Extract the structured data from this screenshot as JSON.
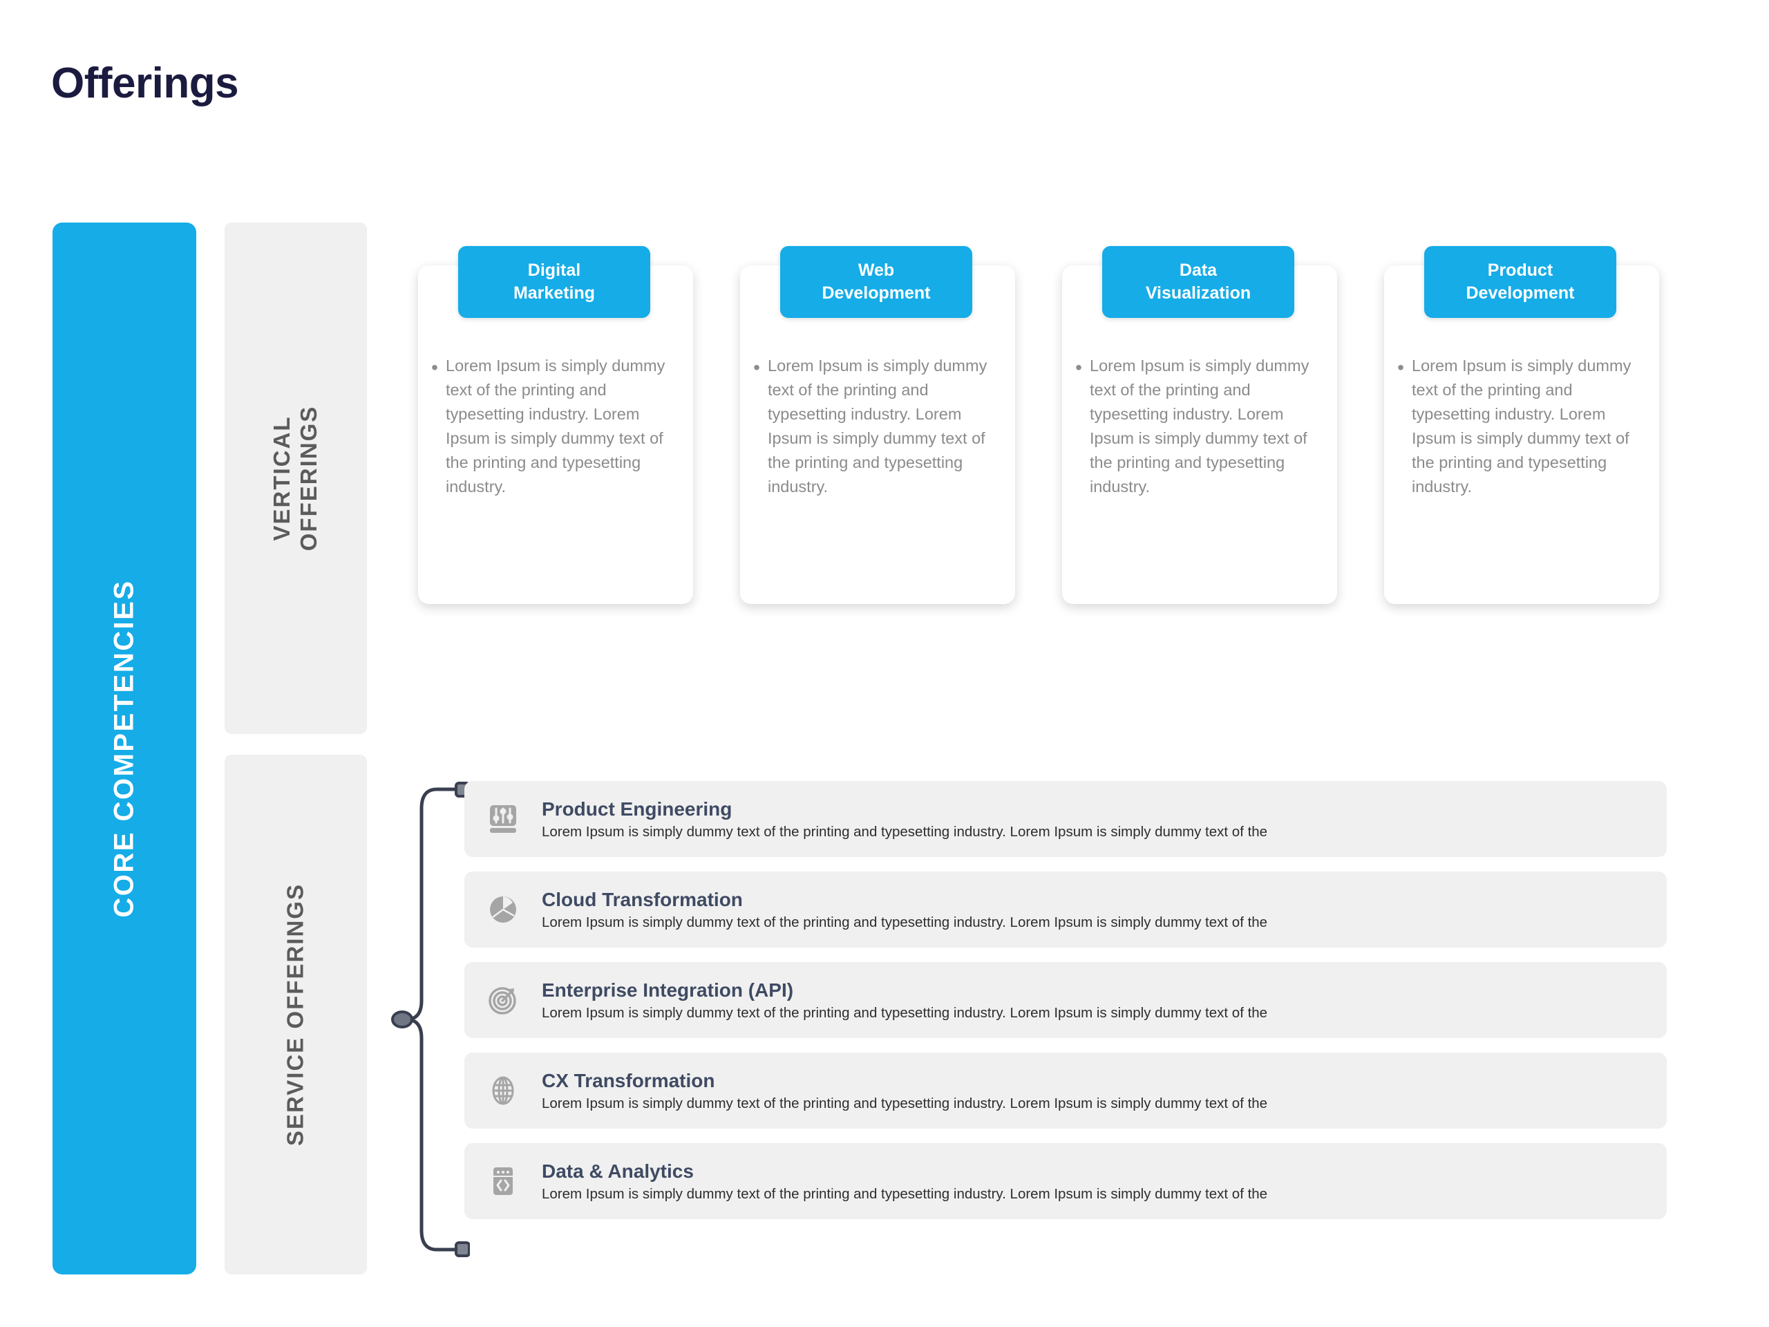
{
  "page": {
    "title": "Offerings",
    "accent_color": "#15ace8",
    "title_color": "#1b1b40",
    "panel_color": "#f0f0f0"
  },
  "core_rail": {
    "label": "CORE COMPETENCIES"
  },
  "categories": {
    "vertical": {
      "label_line1": "VERTICAL",
      "label_line2": "OFFERINGS"
    },
    "service": {
      "label": "SERVICE OFFERINGS"
    }
  },
  "vertical_offerings": {
    "bullet_glyph": "•",
    "cards": [
      {
        "title_line1": "Digital",
        "title_line2": "Marketing",
        "body": "Lorem Ipsum is simply dummy text of the printing and typesetting industry. Lorem Ipsum is simply dummy text of the printing and typesetting industry."
      },
      {
        "title_line1": "Web",
        "title_line2": "Development",
        "body": "Lorem Ipsum is simply dummy text of the printing and typesetting industry. Lorem Ipsum is simply dummy text of the printing and typesetting industry."
      },
      {
        "title_line1": "Data",
        "title_line2": "Visualization",
        "body": "Lorem Ipsum is simply dummy text of the printing and typesetting industry. Lorem Ipsum is simply dummy text of the printing and typesetting industry."
      },
      {
        "title_line1": "Product",
        "title_line2": "Development",
        "body": "Lorem Ipsum is simply dummy text of the printing and typesetting industry. Lorem Ipsum is simply dummy text of the printing and typesetting industry."
      }
    ]
  },
  "service_offerings": {
    "rows": [
      {
        "icon": "sliders-icon",
        "title": "Product Engineering",
        "description": "Lorem Ipsum is simply dummy text of the printing and typesetting industry. Lorem Ipsum is simply dummy text of the"
      },
      {
        "icon": "pie-chart-icon",
        "title": "Cloud Transformation",
        "description": "Lorem Ipsum is simply dummy text of the printing and typesetting industry. Lorem Ipsum is simply dummy text of the"
      },
      {
        "icon": "target-icon",
        "title": "Enterprise Integration (API)",
        "description": "Lorem Ipsum is simply dummy text of the printing and typesetting industry. Lorem Ipsum is simply dummy text of the"
      },
      {
        "icon": "globe-icon",
        "title": "CX Transformation",
        "description": "Lorem Ipsum is simply dummy text of the printing and typesetting industry. Lorem Ipsum is simply dummy text of the"
      },
      {
        "icon": "code-window-icon",
        "title": "Data & Analytics",
        "description": "Lorem Ipsum is simply dummy text of the printing and typesetting industry. Lorem Ipsum is simply dummy text of the"
      }
    ]
  }
}
